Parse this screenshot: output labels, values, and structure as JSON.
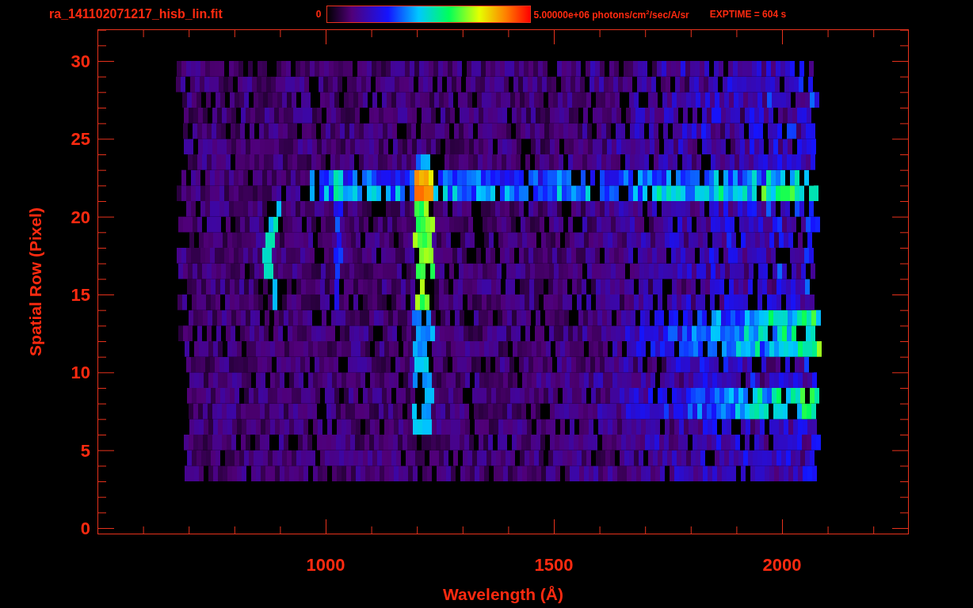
{
  "header": {
    "title": "ra_141102071217_hisb_lin.fit",
    "colorbar_min": "0",
    "colorbar_max": "5.00000e+06 photons/cm$^{2}$/sec/A/sr",
    "exposure": "EXPTIME = 604 s"
  },
  "plot": {
    "y_title": "Spatial Row (Pixel)",
    "x_title": "Wavelength (Å)",
    "y_tick_labels": [
      "30",
      "25",
      "20",
      "15",
      "10",
      "5",
      "0"
    ],
    "x_tick_labels": [
      "1000",
      "1500",
      "2000"
    ]
  }
}
